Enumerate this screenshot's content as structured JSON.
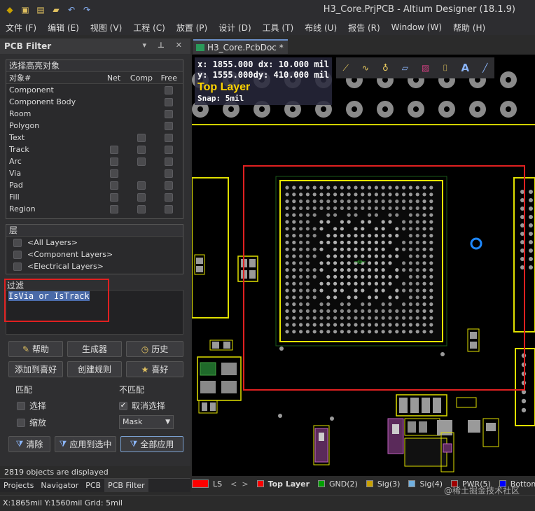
{
  "window": {
    "title": "H3_Core.PrjPCB - Altium Designer (18.1.9)"
  },
  "menu": [
    "文件 (F)",
    "编辑 (E)",
    "视图 (V)",
    "工程 (C)",
    "放置 (P)",
    "设计 (D)",
    "工具 (T)",
    "布线 (U)",
    "报告 (R)",
    "Window (W)",
    "帮助 (H)"
  ],
  "panel": {
    "title": "PCB Filter",
    "highlight_title": "选择高亮对象",
    "obj_header": "对象#",
    "cols": [
      "Net",
      "Comp",
      "Free"
    ],
    "objects": [
      {
        "name": "Component",
        "net": false,
        "comp": false,
        "free": true
      },
      {
        "name": "Component Body",
        "net": false,
        "comp": false,
        "free": true
      },
      {
        "name": "Room",
        "net": false,
        "comp": false,
        "free": true
      },
      {
        "name": "Polygon",
        "net": false,
        "comp": false,
        "free": true
      },
      {
        "name": "Text",
        "net": false,
        "comp": true,
        "free": true
      },
      {
        "name": "Track",
        "net": true,
        "comp": true,
        "free": true
      },
      {
        "name": "Arc",
        "net": true,
        "comp": true,
        "free": true
      },
      {
        "name": "Via",
        "net": true,
        "comp": false,
        "free": true
      },
      {
        "name": "Pad",
        "net": true,
        "comp": true,
        "free": true
      },
      {
        "name": "Fill",
        "net": true,
        "comp": true,
        "free": true
      },
      {
        "name": "Region",
        "net": true,
        "comp": true,
        "free": true
      }
    ],
    "layers_title": "层",
    "layers": [
      "<All Layers>",
      "<Component Layers>",
      "<Electrical Layers>"
    ],
    "filter_label": "过滤",
    "filter_text": "IsVia or IsTrack",
    "buttons": {
      "help": "帮助",
      "builder": "生成器",
      "history": "历史",
      "add_fav": "添加到喜好",
      "create_rule": "创建规则",
      "favorites": "喜好",
      "clear": "清除",
      "apply_sel": "应用到选中",
      "apply_all": "全部应用"
    },
    "match_label": "匹配",
    "nomatch_label": "不匹配",
    "opt_select": "选择",
    "opt_zoom": "缩放",
    "opt_deselect": "取消选择",
    "mask_value": "Mask",
    "status": "2819 objects are displayed"
  },
  "bottom_tabs": [
    "Projects",
    "Navigator",
    "PCB",
    "PCB Filter"
  ],
  "doc_tab": "H3_Core.PcbDoc *",
  "hud": {
    "x": "x: 1855.000",
    "dx": "dx:   10.000 mil",
    "y": "y: 1555.000",
    "dy": "dy:  410.000 mil",
    "layer": "Top Layer",
    "snap": "Snap: 5mil"
  },
  "layer_tabs": [
    {
      "label": "LS",
      "color": "#ff0000"
    },
    {
      "label": "Top Layer",
      "color": "#ff0000"
    },
    {
      "label": "GND(2)",
      "color": "#00a000"
    },
    {
      "label": "Sig(3)",
      "color": "#c8a000"
    },
    {
      "label": "Sig(4)",
      "color": "#70b0e0"
    },
    {
      "label": "PWR(5)",
      "color": "#a00000"
    },
    {
      "label": "Bottom La",
      "color": "#0000ff"
    }
  ],
  "statusbar": "X:1865mil Y:1560mil   Grid: 5mil",
  "watermark": "@稀土掘金技术社区"
}
